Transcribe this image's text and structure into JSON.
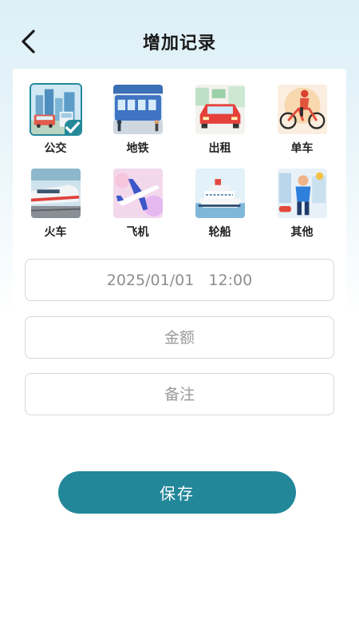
{
  "header": {
    "title": "增加记录",
    "back_icon": "chevron-left-icon"
  },
  "transport_types": [
    {
      "id": "bus",
      "label": "公交",
      "selected": true
    },
    {
      "id": "subway",
      "label": "地铁",
      "selected": false
    },
    {
      "id": "taxi",
      "label": "出租",
      "selected": false
    },
    {
      "id": "bike",
      "label": "单车",
      "selected": false
    },
    {
      "id": "train",
      "label": "火车",
      "selected": false
    },
    {
      "id": "plane",
      "label": "飞机",
      "selected": false
    },
    {
      "id": "ship",
      "label": "轮船",
      "selected": false
    },
    {
      "id": "other",
      "label": "其他",
      "selected": false
    }
  ],
  "form": {
    "datetime_value": "2025/01/01   12:00",
    "amount_placeholder": "金额",
    "note_placeholder": "备注"
  },
  "save_label": "保存",
  "colors": {
    "accent": "#23879a",
    "header_bg": "#dceff7"
  }
}
